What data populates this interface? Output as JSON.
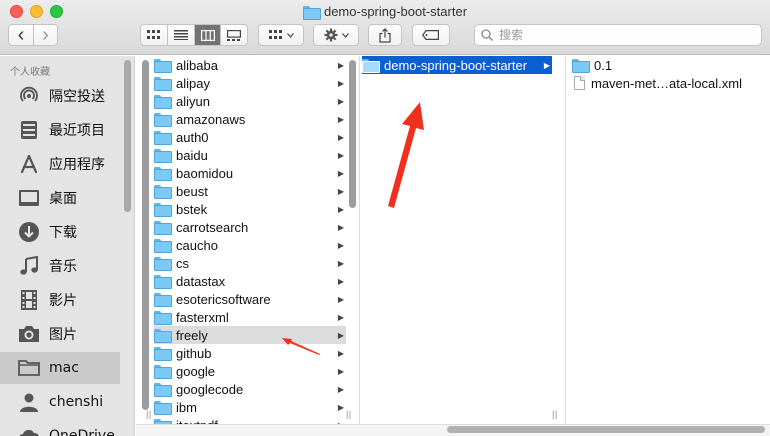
{
  "window": {
    "title": "demo-spring-boot-starter"
  },
  "toolbar": {
    "back_glyph": "‹",
    "forward_glyph": "›",
    "search_placeholder": "搜索"
  },
  "sidebar": {
    "header": "个人收藏",
    "items": [
      {
        "label": "隔空投送",
        "icon": "airdrop-icon"
      },
      {
        "label": "最近项目",
        "icon": "recents-icon"
      },
      {
        "label": "应用程序",
        "icon": "applications-icon"
      },
      {
        "label": "桌面",
        "icon": "desktop-icon"
      },
      {
        "label": "下载",
        "icon": "downloads-icon"
      },
      {
        "label": "音乐",
        "icon": "music-icon"
      },
      {
        "label": "影片",
        "icon": "movies-icon"
      },
      {
        "label": "图片",
        "icon": "pictures-icon"
      },
      {
        "label": "mac",
        "icon": "home-folder-icon",
        "selected": true
      },
      {
        "label": "chenshi",
        "icon": "user-folder-icon"
      },
      {
        "label": "OneDrive",
        "icon": "cloud-icon"
      }
    ]
  },
  "column1": {
    "items": [
      "alibaba",
      "alipay",
      "aliyun",
      "amazonaws",
      "auth0",
      "baidu",
      "baomidou",
      "beust",
      "bstek",
      "carrotsearch",
      "caucho",
      "cs",
      "datastax",
      "esotericsoftware",
      "fasterxml",
      "freely",
      "github",
      "google",
      "googlecode",
      "ibm",
      "itextpdf"
    ],
    "hovered": "freely"
  },
  "column2": {
    "items": [
      "demo-spring-boot-starter"
    ],
    "selected": "demo-spring-boot-starter"
  },
  "column3": {
    "items": [
      {
        "label": "0.1",
        "type": "folder"
      },
      {
        "label": "maven-met…ata-local.xml",
        "type": "file"
      }
    ]
  },
  "colors": {
    "selection": "#0b5fd1",
    "annotation": "#f0301f",
    "folder": "#7dc9f6"
  }
}
